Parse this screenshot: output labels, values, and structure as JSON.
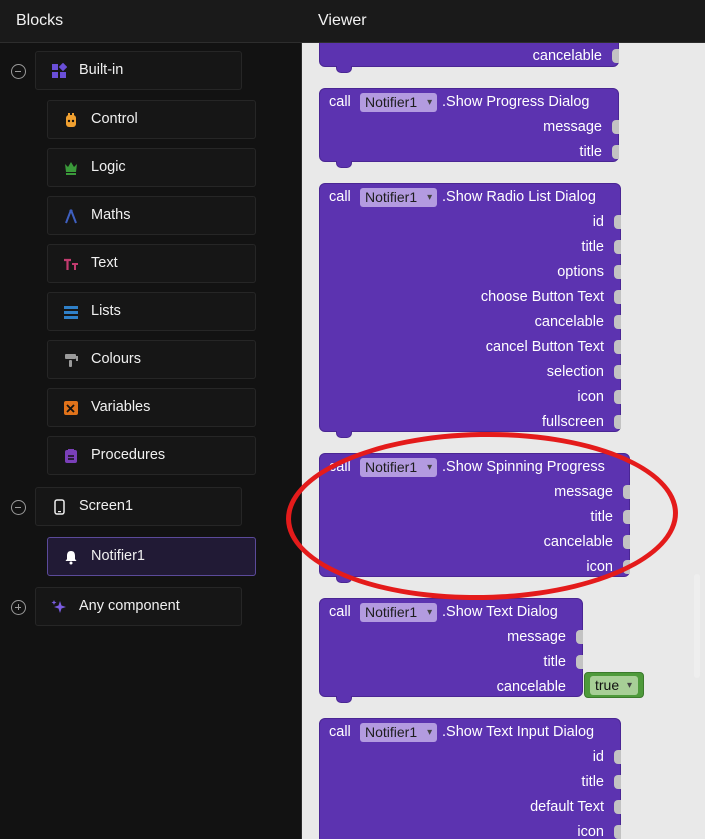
{
  "blocks_panel": {
    "title": "Blocks",
    "builtin": {
      "label": "Built-in",
      "items": [
        {
          "label": "Control",
          "icon": "control-icon",
          "color": "#f0a030"
        },
        {
          "label": "Logic",
          "icon": "logic-icon",
          "color": "#3a9a3a"
        },
        {
          "label": "Maths",
          "icon": "maths-icon",
          "color": "#3e5fbf"
        },
        {
          "label": "Text",
          "icon": "text-icon",
          "color": "#c23b6f"
        },
        {
          "label": "Lists",
          "icon": "lists-icon",
          "color": "#2f80c8"
        },
        {
          "label": "Colours",
          "icon": "colours-icon",
          "color": "#8a8a8a"
        },
        {
          "label": "Variables",
          "icon": "variables-icon",
          "color": "#e0721a"
        },
        {
          "label": "Procedures",
          "icon": "procedures-icon",
          "color": "#7a3fb8"
        }
      ]
    },
    "screen": {
      "label": "Screen1",
      "items": [
        {
          "label": "Notifier1",
          "icon": "bell-icon"
        }
      ]
    },
    "any_component": {
      "label": "Any component"
    }
  },
  "viewer": {
    "title": "Viewer",
    "blocks": [
      {
        "id": "partial",
        "params": [
          "cancelable"
        ]
      },
      {
        "id": "progress",
        "call": "call",
        "component": "Notifier1",
        "method": ".Show Progress Dialog",
        "params": [
          "message",
          "title"
        ]
      },
      {
        "id": "radio",
        "call": "call",
        "component": "Notifier1",
        "method": ".Show Radio List Dialog",
        "params": [
          "id",
          "title",
          "options",
          "choose Button Text",
          "cancelable",
          "cancel Button Text",
          "selection",
          "icon",
          "fullscreen"
        ]
      },
      {
        "id": "spinning",
        "call": "call",
        "component": "Notifier1",
        "method": ".Show Spinning Progress",
        "params": [
          "message",
          "title",
          "cancelable",
          "icon"
        ]
      },
      {
        "id": "textdialog",
        "call": "call",
        "component": "Notifier1",
        "method": ".Show Text Dialog",
        "params": [
          "message",
          "title",
          "cancelable"
        ],
        "attached_value": "true"
      },
      {
        "id": "textinput",
        "call": "call",
        "component": "Notifier1",
        "method": ".Show Text Input Dialog",
        "params": [
          "id",
          "title",
          "default Text",
          "icon"
        ]
      }
    ]
  },
  "colors": {
    "block_purple": "#5c33b0",
    "logic_green": "#4e9a3b",
    "annotation_red": "#e41b1b"
  }
}
